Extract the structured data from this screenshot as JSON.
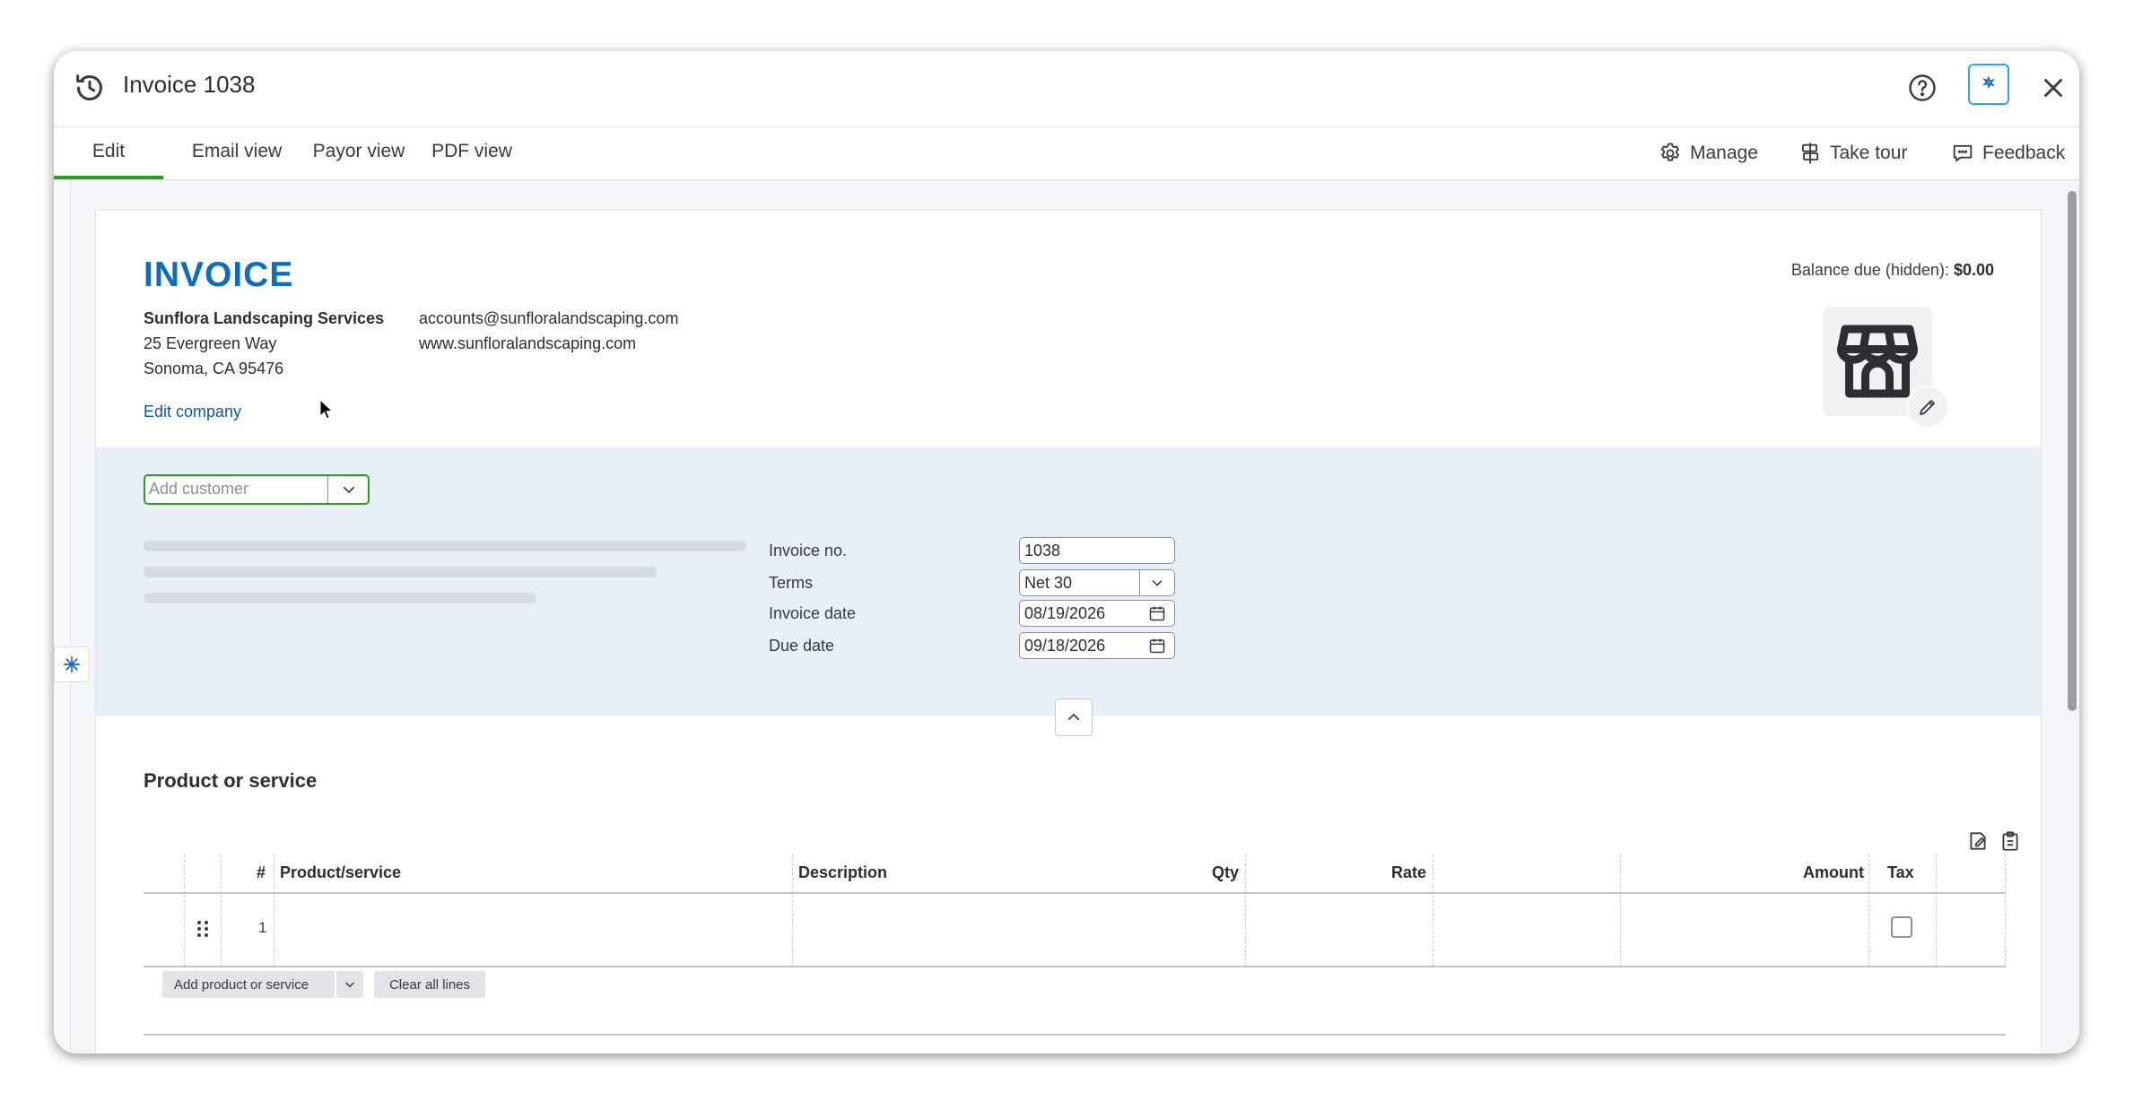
{
  "window": {
    "title": "Invoice 1038"
  },
  "tabs": [
    {
      "label": "Edit",
      "active": true
    },
    {
      "label": "Email view"
    },
    {
      "label": "Payor view"
    },
    {
      "label": "PDF view"
    }
  ],
  "toolbar": {
    "manage": "Manage",
    "take_tour": "Take tour",
    "feedback": "Feedback"
  },
  "invoice": {
    "heading": "INVOICE",
    "company": {
      "name": "Sunflora Landscaping Services",
      "address1": "25 Evergreen Way",
      "address2": "Sonoma, CA 95476",
      "email": "accounts@sunfloralandscaping.com",
      "website": "www.sunfloralandscaping.com",
      "edit_link": "Edit company"
    },
    "balance_label": "Balance due (hidden):",
    "balance_value": "$0.00"
  },
  "customer": {
    "placeholder": "Add customer"
  },
  "fields": {
    "invoice_no_label": "Invoice no.",
    "invoice_no": "1038",
    "terms_label": "Terms",
    "terms": "Net 30",
    "invoice_date_label": "Invoice date",
    "invoice_date": "08/19/2026",
    "due_date_label": "Due date",
    "due_date": "09/18/2026"
  },
  "products": {
    "section_title": "Product or service",
    "columns": {
      "num": "#",
      "product": "Product/service",
      "description": "Description",
      "qty": "Qty",
      "rate": "Rate",
      "amount": "Amount",
      "tax": "Tax"
    },
    "rows": [
      {
        "num": "1",
        "tax": false
      }
    ],
    "add_button": "Add product or service",
    "clear_button": "Clear all lines"
  },
  "colors": {
    "accent_green": "#2ca01c",
    "invoice_blue": "#0d6fb8",
    "customer_bg": "#e7eff9"
  },
  "icons": [
    "history-icon",
    "help-icon",
    "ai-assistant-icon",
    "close-icon",
    "gear-icon",
    "tour-icon",
    "feedback-icon",
    "store-icon",
    "pencil-icon",
    "chevron-down-icon",
    "calendar-icon",
    "chevron-up-icon",
    "drag-handle-icon",
    "edit-columns-icon",
    "clipboard-icon"
  ]
}
